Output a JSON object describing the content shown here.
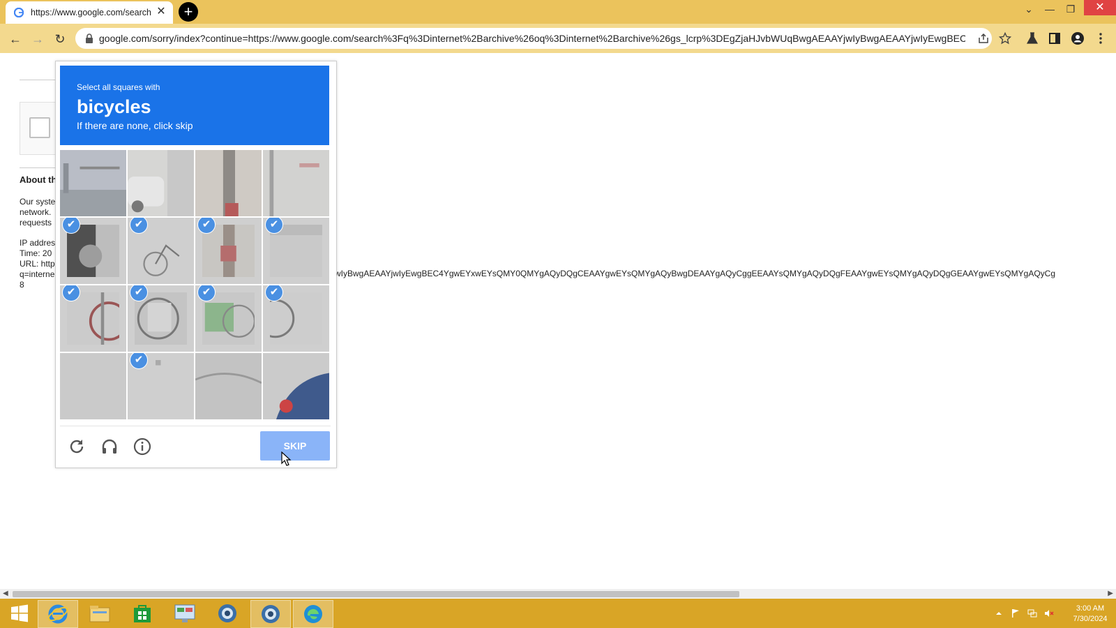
{
  "browser": {
    "tab_title": "https://www.google.com/search",
    "tab_close": "✕",
    "new_tab": "+",
    "url": "google.com/sorry/index?continue=https://www.google.com/search%3Fq%3Dinternet%2Barchive%26oq%3Dinternet%2Barchive%26gs_lcrp%3DEgZjaHJvbWUqBwgAEAAYjwIyBwgAEAAYjwIyEwgBEC4Yg..."
  },
  "page": {
    "about_title": "About th",
    "lines": [
      "Our syste",
      "network.",
      "requests",
      "IP addres",
      "Time: 20",
      "URL: http",
      "q=interne",
      "8"
    ],
    "long_url": "wIyBwgAEAAYjwIyEwgBEC4YgwEYxwEYsQMY0QMYgAQyDQgCEAAYgwEYsQMYgAQyBwgDEAAYgAQyCggEEAAYsQMYgAQyDQgFEAAYgwEYsQMYgAQyDQgGEAAYgwEYsQMYgAQyCg"
  },
  "challenge": {
    "instruction": "Select all squares with",
    "target": "bicycles",
    "subtext": "If there are none, click skip",
    "skip_label": "SKIP",
    "check_glyph": "✔",
    "selected_cells": [
      4,
      5,
      6,
      7,
      8,
      9,
      10,
      11,
      13
    ]
  },
  "clock": {
    "time": "3:00 AM",
    "date": "7/30/2024"
  },
  "colors": {
    "titlebar": "#ebc35c",
    "toolbar": "#f3d98e",
    "header_blue": "#1a73e8",
    "skip_button": "#8ab4f8",
    "check_badge": "#4a90e2",
    "taskbar": "#d9a526"
  }
}
